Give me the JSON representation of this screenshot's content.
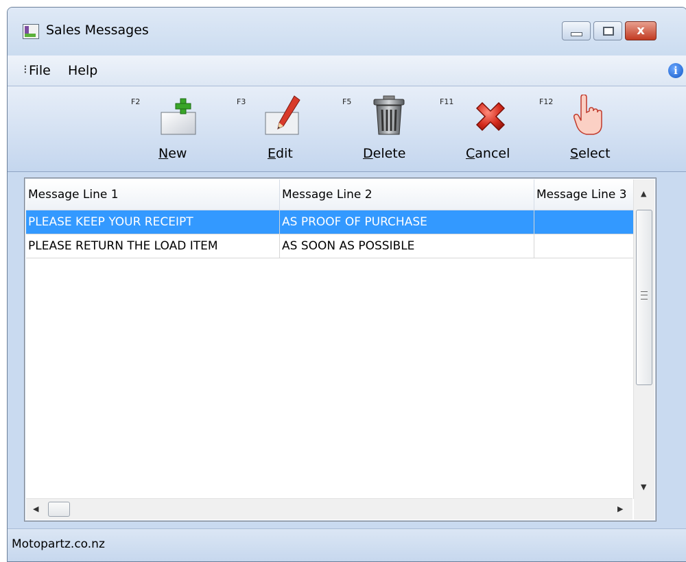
{
  "window": {
    "title": "Sales Messages",
    "close_glyph": "x"
  },
  "menu": {
    "file": "File",
    "help": "Help",
    "info": "i"
  },
  "toolbar": {
    "items": [
      {
        "key": "F2",
        "label": "New",
        "icon": "new-document-icon"
      },
      {
        "key": "F3",
        "label": "Edit",
        "icon": "edit-pencil-icon"
      },
      {
        "key": "F5",
        "label": "Delete",
        "icon": "trash-can-icon"
      },
      {
        "key": "F11",
        "label": "Cancel",
        "icon": "red-x-icon"
      },
      {
        "key": "F12",
        "label": "Select",
        "icon": "pointing-hand-icon"
      }
    ]
  },
  "grid": {
    "columns": [
      "Message Line 1",
      "Message Line 2",
      "Message Line 3"
    ],
    "rows": [
      {
        "line1": "PLEASE KEEP YOUR RECEIPT",
        "line2": "AS PROOF OF PURCHASE",
        "line3": "",
        "selected": true
      },
      {
        "line1": "PLEASE RETURN THE LOAD ITEM",
        "line2": "AS SOON AS POSSIBLE",
        "line3": "",
        "selected": false
      }
    ]
  },
  "status": {
    "text": "Motopartz.co.nz"
  },
  "colors": {
    "selection": "#3399ff",
    "window_frame": "#c9daf0",
    "close_button": "#c23a22"
  }
}
